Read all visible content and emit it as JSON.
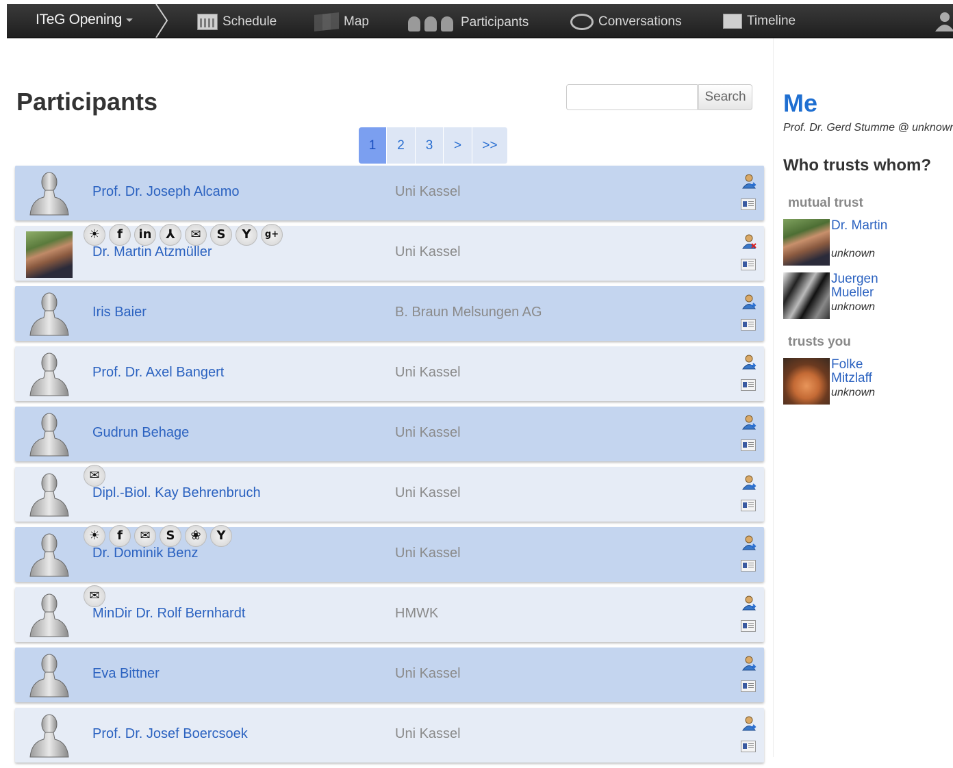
{
  "nav": {
    "brand": "ITeG Opening",
    "items": [
      {
        "label": "Schedule",
        "icon": "calendar-icon"
      },
      {
        "label": "Map",
        "icon": "map-icon"
      },
      {
        "label": "Participants",
        "icon": "people-icon"
      },
      {
        "label": "Conversations",
        "icon": "chat-icon"
      },
      {
        "label": "Timeline",
        "icon": "timeline-icon"
      }
    ]
  },
  "page": {
    "title": "Participants",
    "search": {
      "value": "",
      "button": "Search"
    },
    "pagination": [
      "1",
      "2",
      "3",
      ">",
      ">>"
    ],
    "current_page": "1"
  },
  "participants": [
    {
      "name": "Prof. Dr. Joseph Alcamo",
      "affiliation": "Uni Kassel",
      "avatar": "default-avatar",
      "socials": []
    },
    {
      "name": "Dr. Martin Atzmüller",
      "affiliation": "Uni Kassel",
      "avatar": "photo",
      "socials": [
        "☀",
        "f",
        "in",
        "⅄",
        "✉",
        "S",
        "Y",
        "g+"
      ],
      "trust_icon": "remove-trust-icon"
    },
    {
      "name": "Iris Baier",
      "affiliation": "B. Braun Melsungen AG",
      "avatar": "default-avatar",
      "socials": []
    },
    {
      "name": "Prof. Dr. Axel Bangert",
      "affiliation": "Uni Kassel",
      "avatar": "default-avatar",
      "socials": []
    },
    {
      "name": "Gudrun Behage",
      "affiliation": "Uni Kassel",
      "avatar": "default-avatar",
      "socials": []
    },
    {
      "name": "Dipl.-Biol. Kay Behrenbruch",
      "affiliation": "Uni Kassel",
      "avatar": "default-avatar",
      "socials": [
        "✉"
      ]
    },
    {
      "name": "Dr. Dominik Benz",
      "affiliation": "Uni Kassel",
      "avatar": "default-avatar",
      "socials": [
        "☀",
        "f",
        "✉",
        "S",
        "❀",
        "Y"
      ]
    },
    {
      "name": "MinDir Dr. Rolf Bernhardt",
      "affiliation": "HMWK",
      "avatar": "default-avatar",
      "socials": [
        "✉"
      ]
    },
    {
      "name": "Eva Bittner",
      "affiliation": "Uni Kassel",
      "avatar": "default-avatar",
      "socials": []
    },
    {
      "name": "Prof. Dr. Josef Boercsoek",
      "affiliation": "Uni Kassel",
      "avatar": "default-avatar",
      "socials": []
    }
  ],
  "sidebar": {
    "me_title": "Me",
    "me_subtitle": "Prof. Dr. Gerd Stumme @ unknown",
    "who_trusts_title": "Who trusts whom?",
    "mutual_trust_heading": "mutual trust",
    "mutual_trust": [
      {
        "name": "Dr. Martin",
        "sub": "unknown",
        "photo": "photo-martin"
      },
      {
        "name": "Juergen Mueller",
        "sub": "unknown",
        "photo": "photo-juergen"
      }
    ],
    "trusts_you_heading": "trusts you",
    "trusts_you": [
      {
        "name": "Folke Mitzlaff",
        "sub": "unknown",
        "photo": "photo-folke"
      }
    ]
  },
  "colors": {
    "nav_bg": "#2a2a2a",
    "row_odd": "#c4d5ef",
    "row_even": "#e6ecf6",
    "link": "#2b62c0",
    "me_title": "#1f6fd1",
    "active_page": "#7b9ff0"
  }
}
